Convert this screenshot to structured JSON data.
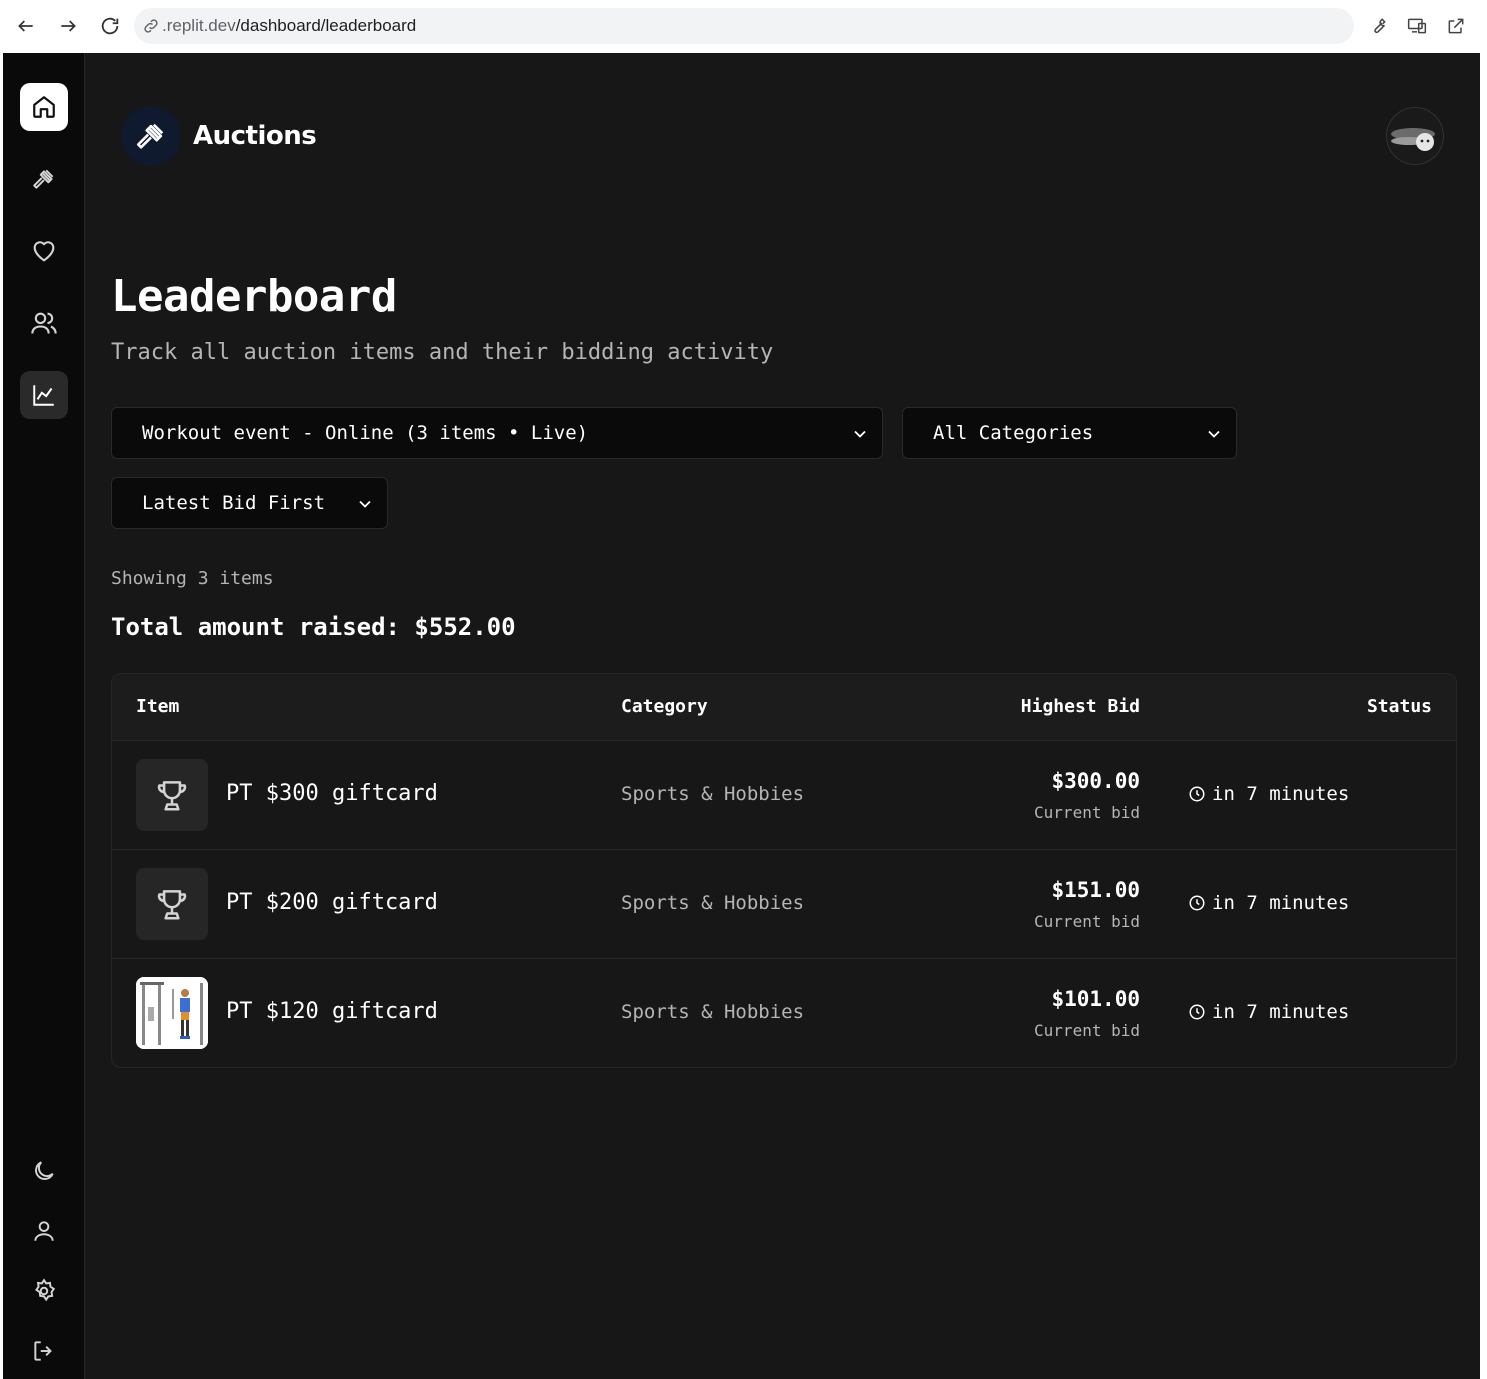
{
  "browser": {
    "url_host": ".replit.dev",
    "url_path": "/dashboard/leaderboard"
  },
  "brand": {
    "title": "Auctions"
  },
  "page": {
    "title": "Leaderboard",
    "subtitle": "Track all auction items and their bidding activity"
  },
  "filters": {
    "event": "Workout event - Online (3 items • Live)",
    "category": "All Categories",
    "sort": "Latest Bid First"
  },
  "summary": {
    "showing": "Showing 3 items",
    "total": "Total amount raised: $552.00"
  },
  "table": {
    "headers": {
      "item": "Item",
      "category": "Category",
      "highest_bid": "Highest Bid",
      "status": "Status"
    },
    "rows": [
      {
        "name": "PT $300 giftcard",
        "category": "Sports & Hobbies",
        "bid": "$300.00",
        "bid_label": "Current bid",
        "status": "in 7 minutes",
        "thumb": "trophy-icon"
      },
      {
        "name": "PT $200 giftcard",
        "category": "Sports & Hobbies",
        "bid": "$151.00",
        "bid_label": "Current bid",
        "status": "in 7 minutes",
        "thumb": "trophy-icon"
      },
      {
        "name": "PT $120 giftcard",
        "category": "Sports & Hobbies",
        "bid": "$101.00",
        "bid_label": "Current bid",
        "status": "in 7 minutes",
        "thumb": "photo"
      }
    ]
  },
  "sidebar": {
    "items": [
      "home-icon",
      "gavel-icon",
      "heart-icon",
      "users-icon",
      "chart-icon"
    ],
    "bottom": [
      "moon-icon",
      "user-icon",
      "settings-icon",
      "logout-icon"
    ]
  },
  "colors": {
    "background": "#171717",
    "sidebar": "#0a0a0a",
    "brand_badge": "#0f1a2f"
  }
}
